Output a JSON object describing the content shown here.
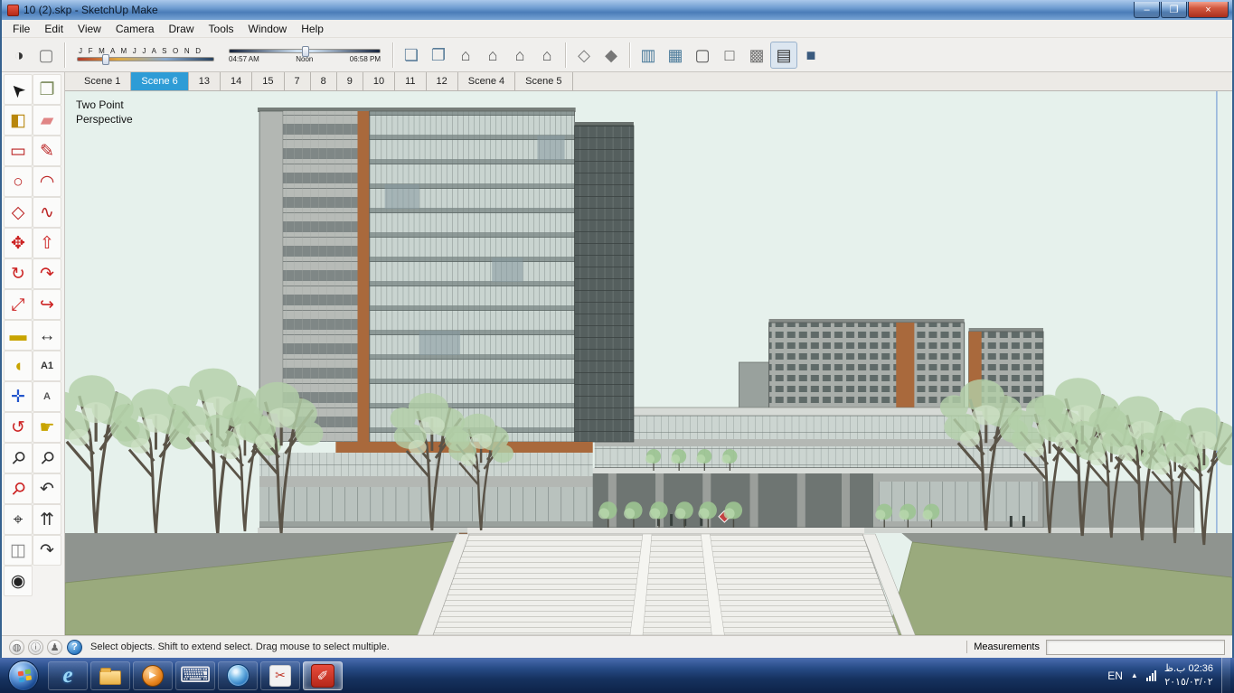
{
  "titlebar": {
    "title": "10 (2).skp - SketchUp Make",
    "controls": [
      {
        "name": "minimize-button",
        "glyph": "–"
      },
      {
        "name": "maximize-button",
        "glyph": "❐"
      },
      {
        "name": "close-button",
        "glyph": "×"
      }
    ]
  },
  "menubar": {
    "items": [
      "File",
      "Edit",
      "View",
      "Camera",
      "Draw",
      "Tools",
      "Window",
      "Help"
    ]
  },
  "toolbar": {
    "left_icons": [
      {
        "name": "shadow-settings-icon",
        "glyph": "◑",
        "color": "#333333"
      },
      {
        "name": "toggle-shadows-icon",
        "glyph": "▢",
        "color": "#777777"
      }
    ],
    "date_slider": {
      "months": "J F M A M J J A S O N D",
      "position_pct": 18
    },
    "time_slider": {
      "start": "04:57 AM",
      "mid": "Noon",
      "end": "06:58 PM",
      "position_pct": 48
    },
    "icon_groups": [
      {
        "name": "views",
        "icons": [
          {
            "name": "orthographic-view-icon",
            "glyph": "❏",
            "color": "#5a7d9a"
          },
          {
            "name": "perspective-view-icon",
            "glyph": "❐",
            "color": "#5a7d9a"
          },
          {
            "name": "iso-view-icon",
            "glyph": "⌂",
            "color": "#555555"
          },
          {
            "name": "top-view-icon",
            "glyph": "⌂",
            "color": "#555555"
          },
          {
            "name": "front-view-icon",
            "glyph": "⌂",
            "color": "#555555"
          },
          {
            "name": "right-view-icon",
            "glyph": "⌂",
            "color": "#555555"
          }
        ]
      },
      {
        "name": "section",
        "icons": [
          {
            "name": "section-plane-icon",
            "glyph": "◇",
            "color": "#777777"
          },
          {
            "name": "section-cut-icon",
            "glyph": "◆",
            "color": "#777777"
          }
        ]
      },
      {
        "name": "styles",
        "icons": [
          {
            "name": "x-ray-style-icon",
            "glyph": "▥",
            "color": "#4a7a9a"
          },
          {
            "name": "back-edges-style-icon",
            "glyph": "▦",
            "color": "#4a7a9a"
          },
          {
            "name": "wireframe-style-icon",
            "glyph": "▢",
            "color": "#555555"
          },
          {
            "name": "hidden-line-style-icon",
            "glyph": "□",
            "color": "#555555"
          },
          {
            "name": "shaded-style-icon",
            "glyph": "▩",
            "color": "#777777"
          },
          {
            "name": "shaded-textures-style-icon",
            "glyph": "▤",
            "color": "#333333",
            "active": true
          },
          {
            "name": "monochrome-style-icon",
            "glyph": "■",
            "color": "#3a5a7e"
          }
        ]
      }
    ]
  },
  "scene_tabs": [
    {
      "label": "Scene 1"
    },
    {
      "label": "Scene 6",
      "active": true
    },
    {
      "label": "13"
    },
    {
      "label": "14"
    },
    {
      "label": "15"
    },
    {
      "label": "7"
    },
    {
      "label": "8"
    },
    {
      "label": "9"
    },
    {
      "label": "10"
    },
    {
      "label": "11"
    },
    {
      "label": "12"
    },
    {
      "label": "Scene 4"
    },
    {
      "label": "Scene 5"
    }
  ],
  "tool_palette": [
    {
      "name": "select-tool",
      "glyph": "➤",
      "color": "#1a1a1a",
      "rot": -135
    },
    {
      "name": "make-component-tool",
      "glyph": "❐",
      "color": "#7a8a5a"
    },
    {
      "name": "paint-bucket-tool",
      "glyph": "◧",
      "color": "#b8860b"
    },
    {
      "name": "eraser-tool",
      "glyph": "▰",
      "color": "#e08585"
    },
    {
      "name": "rectangle-tool",
      "glyph": "▭",
      "color": "#bb2222"
    },
    {
      "name": "line-tool",
      "glyph": "✎",
      "color": "#bb2222"
    },
    {
      "name": "circle-tool",
      "glyph": "○",
      "color": "#bb2222"
    },
    {
      "name": "arc-tool",
      "glyph": "◠",
      "color": "#bb2222"
    },
    {
      "name": "polygon-tool",
      "glyph": "◇",
      "color": "#bb2222"
    },
    {
      "name": "freehand-tool",
      "glyph": "∿",
      "color": "#bb2222"
    },
    {
      "name": "move-tool",
      "glyph": "✥",
      "color": "#cc2222"
    },
    {
      "name": "push-pull-tool",
      "glyph": "⇧",
      "color": "#cc2222"
    },
    {
      "name": "rotate-tool",
      "glyph": "↻",
      "color": "#cc2222"
    },
    {
      "name": "follow-me-tool",
      "glyph": "↷",
      "color": "#cc2222"
    },
    {
      "name": "scale-tool",
      "glyph": "⤢",
      "color": "#cc2222"
    },
    {
      "name": "offset-tool",
      "glyph": "↪",
      "color": "#cc2222"
    },
    {
      "name": "tape-measure-tool",
      "glyph": "▬",
      "color": "#c8a400"
    },
    {
      "name": "dimension-tool",
      "glyph": "↔",
      "color": "#333333"
    },
    {
      "name": "protractor-tool",
      "glyph": "◖",
      "color": "#c8a400"
    },
    {
      "name": "text-tool",
      "glyph": "A1",
      "color": "#333333",
      "small": true
    },
    {
      "name": "axes-tool",
      "glyph": "✛",
      "color": "#2255cc"
    },
    {
      "name": "3d-text-tool",
      "glyph": "A",
      "color": "#555555",
      "small": true
    },
    {
      "name": "orbit-tool",
      "glyph": "↺",
      "color": "#cc2222"
    },
    {
      "name": "pan-tool",
      "glyph": "☛",
      "color": "#c8a400"
    },
    {
      "name": "zoom-tool",
      "glyph": "⚲",
      "color": "#333333",
      "rot": 45
    },
    {
      "name": "zoom-window-tool",
      "glyph": "⚲",
      "color": "#333333",
      "rot": 45
    },
    {
      "name": "zoom-extents-tool",
      "glyph": "⚲",
      "color": "#cc2222",
      "rot": 45
    },
    {
      "name": "previous-view-tool",
      "glyph": "↶",
      "color": "#333333"
    },
    {
      "name": "position-camera-tool",
      "glyph": "⌖",
      "color": "#333333"
    },
    {
      "name": "walk-tool",
      "glyph": "⇈",
      "color": "#333333"
    },
    {
      "name": "section-plane-tool",
      "glyph": "◫",
      "color": "#888888"
    },
    {
      "name": "next-view-tool",
      "glyph": "↷",
      "color": "#333333"
    },
    {
      "name": "look-around-tool",
      "glyph": "◉",
      "color": "#222222"
    }
  ],
  "viewport": {
    "annotation_line1": "Two Point",
    "annotation_line2": "Perspective"
  },
  "statusbar": {
    "icons": [
      {
        "name": "geolocation-icon",
        "glyph": "◍"
      },
      {
        "name": "claim-credit-icon",
        "glyph": "ⓘ"
      },
      {
        "name": "sign-in-icon",
        "glyph": "♟"
      }
    ],
    "help_glyph": "?",
    "message": "Select objects. Shift to extend select. Drag mouse to select multiple.",
    "measurements_label": "Measurements",
    "measurements_value": ""
  },
  "taskbar": {
    "apps": [
      {
        "name": "internet-explorer"
      },
      {
        "name": "windows-explorer"
      },
      {
        "name": "media-player"
      },
      {
        "name": "on-screen-keyboard"
      },
      {
        "name": "google-earth"
      },
      {
        "name": "snipping-tool"
      },
      {
        "name": "sketchup",
        "active": true
      }
    ],
    "tray": {
      "language": "EN",
      "caret": "▲",
      "time": "02:36 ب.ظ",
      "date": "٢٠١٥/٠٣/٠٢"
    }
  }
}
